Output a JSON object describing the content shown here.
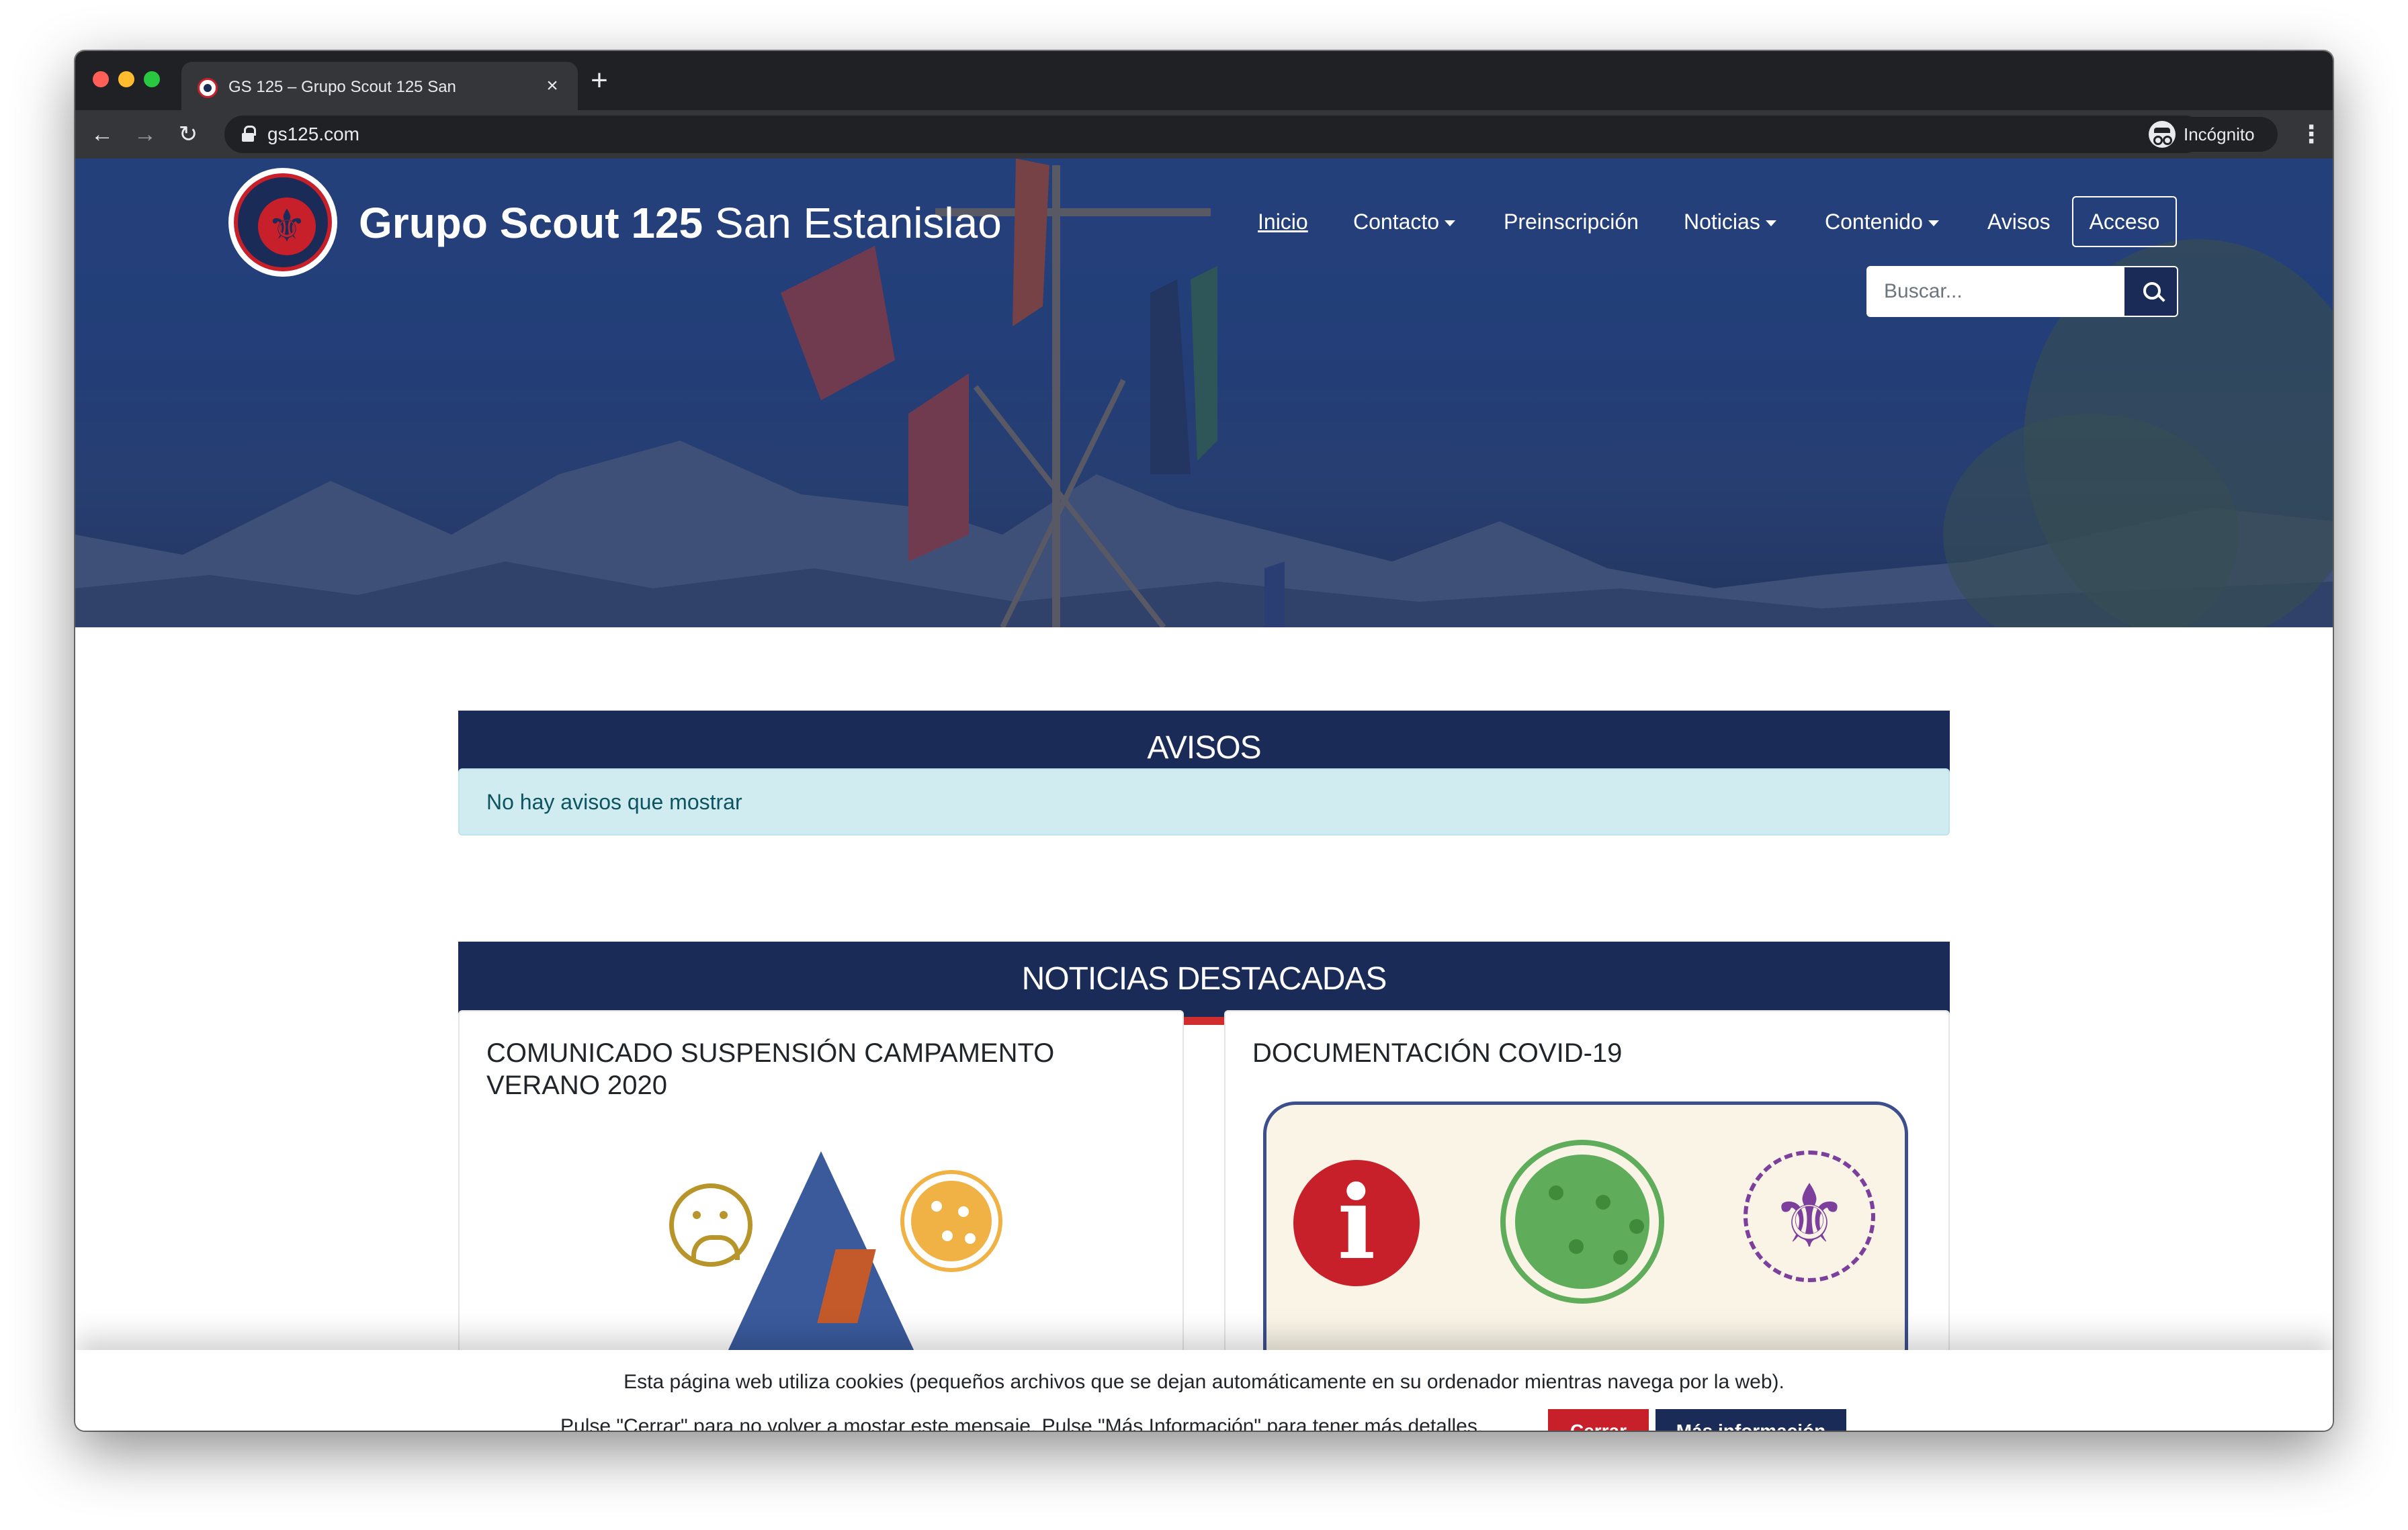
{
  "browser": {
    "tab_title": "GS 125 – Grupo Scout 125 San",
    "url": "gs125.com",
    "incognito_label": "Incógnito",
    "icons": [
      "back-icon",
      "forward-icon",
      "reload-icon",
      "lock-icon",
      "star-icon",
      "incognito-icon",
      "menu-icon",
      "close-icon",
      "plus-icon"
    ],
    "accent_color": "#8ab4f8"
  },
  "site": {
    "title_bold": "Grupo Scout 125",
    "title_rest": " San Estanislao",
    "nav": [
      {
        "label": "Inicio"
      },
      {
        "label": "Contacto"
      },
      {
        "label": "Preinscripción"
      },
      {
        "label": "Noticias"
      },
      {
        "label": "Contenido"
      },
      {
        "label": "Avisos"
      }
    ],
    "login_label": "Acceso",
    "search_placeholder": "Buscar...",
    "brand_navy": "#1b2b57",
    "brand_red": "#d02e2e"
  },
  "avisos": {
    "header": "AVISOS",
    "empty_message": "No hay avisos que mostrar"
  },
  "noticias": {
    "header": "NOTICIAS DESTACADAS",
    "cards": [
      {
        "title": "COMUNICADO SUSPENSIÓN CAMPAMENTO VERANO 2020"
      },
      {
        "title": "DOCUMENTACIÓN COVID-19"
      }
    ]
  },
  "cookie_bar": {
    "line1": "Esta página web utiliza cookies (pequeños archivos que se dejan automáticamente en su ordenador mientras navega por la web).",
    "line2": "Pulse \"Cerrar\" para no volver a mostar este mensaje. Pulse \"Más Información\" para tener más detalles.",
    "close_label": "Cerrar",
    "more_label": "Más información"
  }
}
